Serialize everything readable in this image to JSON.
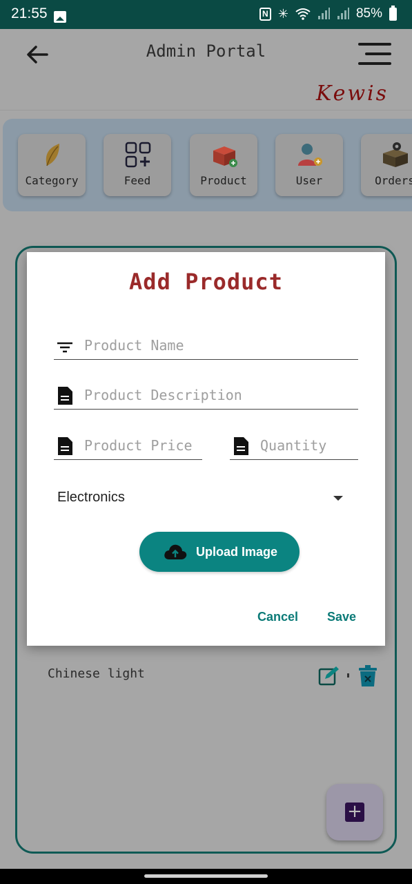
{
  "status_bar": {
    "time": "21:55",
    "battery": "85%"
  },
  "app_bar": {
    "title": "Admin Portal",
    "brand": "Kewis"
  },
  "categories": [
    {
      "label": "Category",
      "icon": "leaf-icon"
    },
    {
      "label": "Feed",
      "icon": "grid-plus-icon"
    },
    {
      "label": "Product",
      "icon": "box-add-icon"
    },
    {
      "label": "User",
      "icon": "user-add-icon"
    },
    {
      "label": "Orders",
      "icon": "box-gear-icon"
    }
  ],
  "list": {
    "item_text": "Chinese light"
  },
  "dialog": {
    "title": "Add Product",
    "product_name_placeholder": "Product Name",
    "product_description_placeholder": "Product Description",
    "product_price_placeholder": "Product Price",
    "quantity_placeholder": "Quantity",
    "category_selected": "Electronics",
    "upload_label": "Upload Image",
    "cancel_label": "Cancel",
    "save_label": "Save"
  },
  "colors": {
    "accent": "#0b8481",
    "title": "#9a2a2a",
    "status_bar": "#0a4a44"
  }
}
